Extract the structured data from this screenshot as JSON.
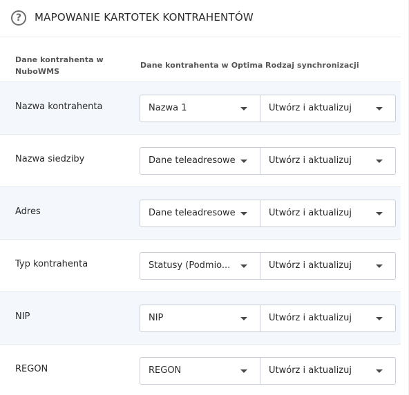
{
  "header": {
    "title": "MAPOWANIE KARTOTEK KONTRAHENTÓW",
    "help_icon": "?"
  },
  "columns": {
    "nubo": "Dane kontrahenta w NuboWMS",
    "optima": "Dane kontrahenta w Optima",
    "sync": "Rodzaj synchronizacji"
  },
  "rows": [
    {
      "label": "Nazwa kontrahenta",
      "optima_value": "Nazwa 1",
      "sync_value": "Utwórz i aktualizuj"
    },
    {
      "label": "Nazwa siedziby",
      "optima_value": "Dane teleadresowe",
      "sync_value": "Utwórz i aktualizuj"
    },
    {
      "label": "Adres",
      "optima_value": "Dane teleadresowe",
      "sync_value": "Utwórz i aktualizuj"
    },
    {
      "label": "Typ kontrahenta",
      "optima_value": "Statusy (Podmio...",
      "sync_value": "Utwórz i aktualizuj"
    },
    {
      "label": "NIP",
      "optima_value": "NIP",
      "sync_value": "Utwórz i aktualizuj"
    },
    {
      "label": "REGON",
      "optima_value": "REGON",
      "sync_value": "Utwórz i aktualizuj"
    }
  ],
  "colors": {
    "row_alt_bg": "#f4f8fc",
    "border": "#c9ced6"
  }
}
